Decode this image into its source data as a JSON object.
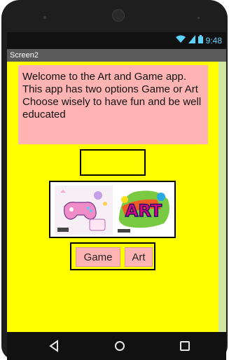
{
  "status_bar": {
    "time": "9:48",
    "wifi_icon": "wifi-icon",
    "signal_icon": "signal-icon",
    "battery_icon": "battery-icon"
  },
  "title_bar": {
    "title": "Screen2"
  },
  "content": {
    "welcome_text": "Welcome to the Art and Game app. This app has two options Game or Art Choose wisely to have fun and be well educated",
    "images": [
      {
        "icon": "game-image"
      },
      {
        "icon": "art-image"
      }
    ],
    "buttons": {
      "game_label": "Game",
      "art_label": "Art"
    }
  },
  "nav_bar": {
    "back_icon": "back-icon",
    "home_icon": "home-icon",
    "recent_icon": "recent-apps-icon"
  },
  "colors": {
    "background": "#ffff00",
    "pink": "#ffb3b3",
    "title_bar": "#5a5a5a"
  }
}
